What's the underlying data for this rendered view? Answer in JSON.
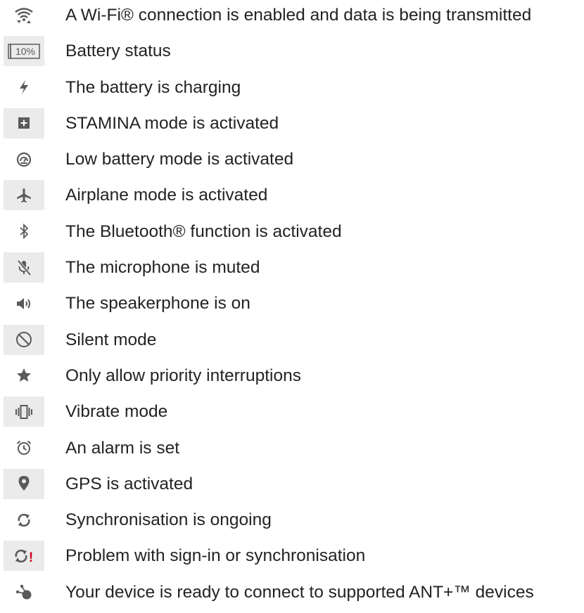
{
  "colors": {
    "icon": "#5a5a5a",
    "cell_shade": "#ebebeb",
    "alert": "#d0021b",
    "text": "#232323"
  },
  "icons": [
    {
      "icon": "wifi-data-icon",
      "label": "A Wi-Fi® connection is enabled and data is being transmitted",
      "shaded": false
    },
    {
      "icon": "battery-status-icon",
      "label": "Battery status",
      "shaded": true,
      "icon_text": "10%"
    },
    {
      "icon": "battery-charging-icon",
      "label": "The battery is charging",
      "shaded": false
    },
    {
      "icon": "stamina-mode-icon",
      "label": "STAMINA mode is activated",
      "shaded": true
    },
    {
      "icon": "low-battery-mode-icon",
      "label": "Low battery mode is activated",
      "shaded": false
    },
    {
      "icon": "airplane-mode-icon",
      "label": "Airplane mode is activated",
      "shaded": true
    },
    {
      "icon": "bluetooth-icon",
      "label": "The Bluetooth® function is activated",
      "shaded": false
    },
    {
      "icon": "microphone-muted-icon",
      "label": "The microphone is muted",
      "shaded": true
    },
    {
      "icon": "speakerphone-icon",
      "label": "The speakerphone is on",
      "shaded": false
    },
    {
      "icon": "silent-mode-icon",
      "label": "Silent mode",
      "shaded": true
    },
    {
      "icon": "priority-star-icon",
      "label": "Only allow priority interruptions",
      "shaded": false
    },
    {
      "icon": "vibrate-mode-icon",
      "label": "Vibrate mode",
      "shaded": true
    },
    {
      "icon": "alarm-clock-icon",
      "label": "An alarm is set",
      "shaded": false
    },
    {
      "icon": "gps-location-icon",
      "label": "GPS is activated",
      "shaded": true
    },
    {
      "icon": "sync-icon",
      "label": "Synchronisation is ongoing",
      "shaded": false
    },
    {
      "icon": "sync-problem-icon",
      "label": "Problem with sign-in or synchronisation",
      "shaded": true,
      "icon_text": "!"
    },
    {
      "icon": "ant-plus-icon",
      "label": "Your device is ready to connect to supported ANT+™ devices",
      "shaded": false
    }
  ]
}
